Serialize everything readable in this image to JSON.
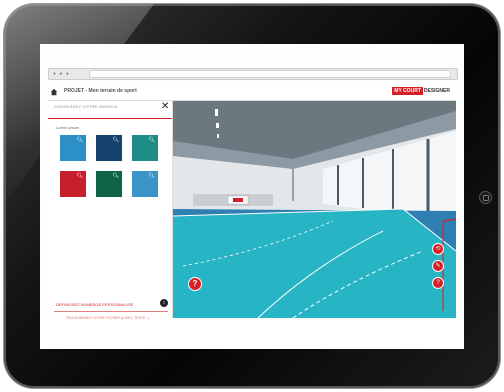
{
  "app": {
    "title": "PROJET - Mon terrain de sport",
    "brand_badge": "MY COURT",
    "brand_rest": "DESIGNER"
  },
  "browser": {
    "dots": "● ● ●"
  },
  "panel": {
    "title": "CHOISISSEZ VOTRE MODELE",
    "close": "✕",
    "subtitle": "Lorem ipsum",
    "swatches": [
      {
        "color": "#2c8fc6"
      },
      {
        "color": "#16436e"
      },
      {
        "color": "#1f8c86"
      },
      {
        "color": "#c81f2d"
      },
      {
        "color": "#0f6448"
      },
      {
        "color": "#3a94c6"
      }
    ],
    "custom_label": "DEFINISSEZ NUMEROS PERSONNALISE",
    "info": "i",
    "upload_label": "TELECHARGEZ VOTRE FICHIER (LOGO, TEXTE...)",
    "file_placeholder": "Aucun fichier sélectionné",
    "upload_icon": "⬆"
  },
  "viewport": {
    "help": "?",
    "tools": [
      "⟲",
      "✎",
      "?"
    ]
  },
  "colors": {
    "accent": "#d61f26",
    "court": "#27b4c4",
    "floor": "#2f7fb3"
  }
}
